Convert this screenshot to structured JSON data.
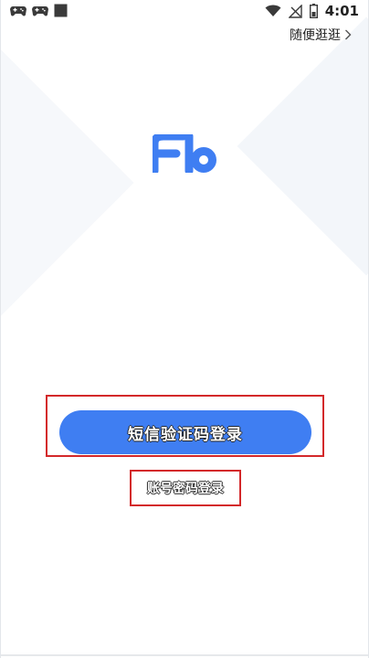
{
  "status_bar": {
    "time": "4:01",
    "left_icons": [
      "gamepad-icon",
      "gamepad-icon",
      "square-icon"
    ],
    "right_icons": [
      "wifi-icon",
      "no-signal-icon",
      "battery-icon"
    ]
  },
  "header": {
    "stroll_label": "随便逛逛"
  },
  "logo": {
    "text": "Fb",
    "color": "#3f7ef2"
  },
  "login": {
    "sms_label": "短信验证码登录",
    "password_label": "账号密码登录"
  },
  "colors": {
    "accent": "#3f7ef2",
    "highlight_border": "#d3282a"
  }
}
